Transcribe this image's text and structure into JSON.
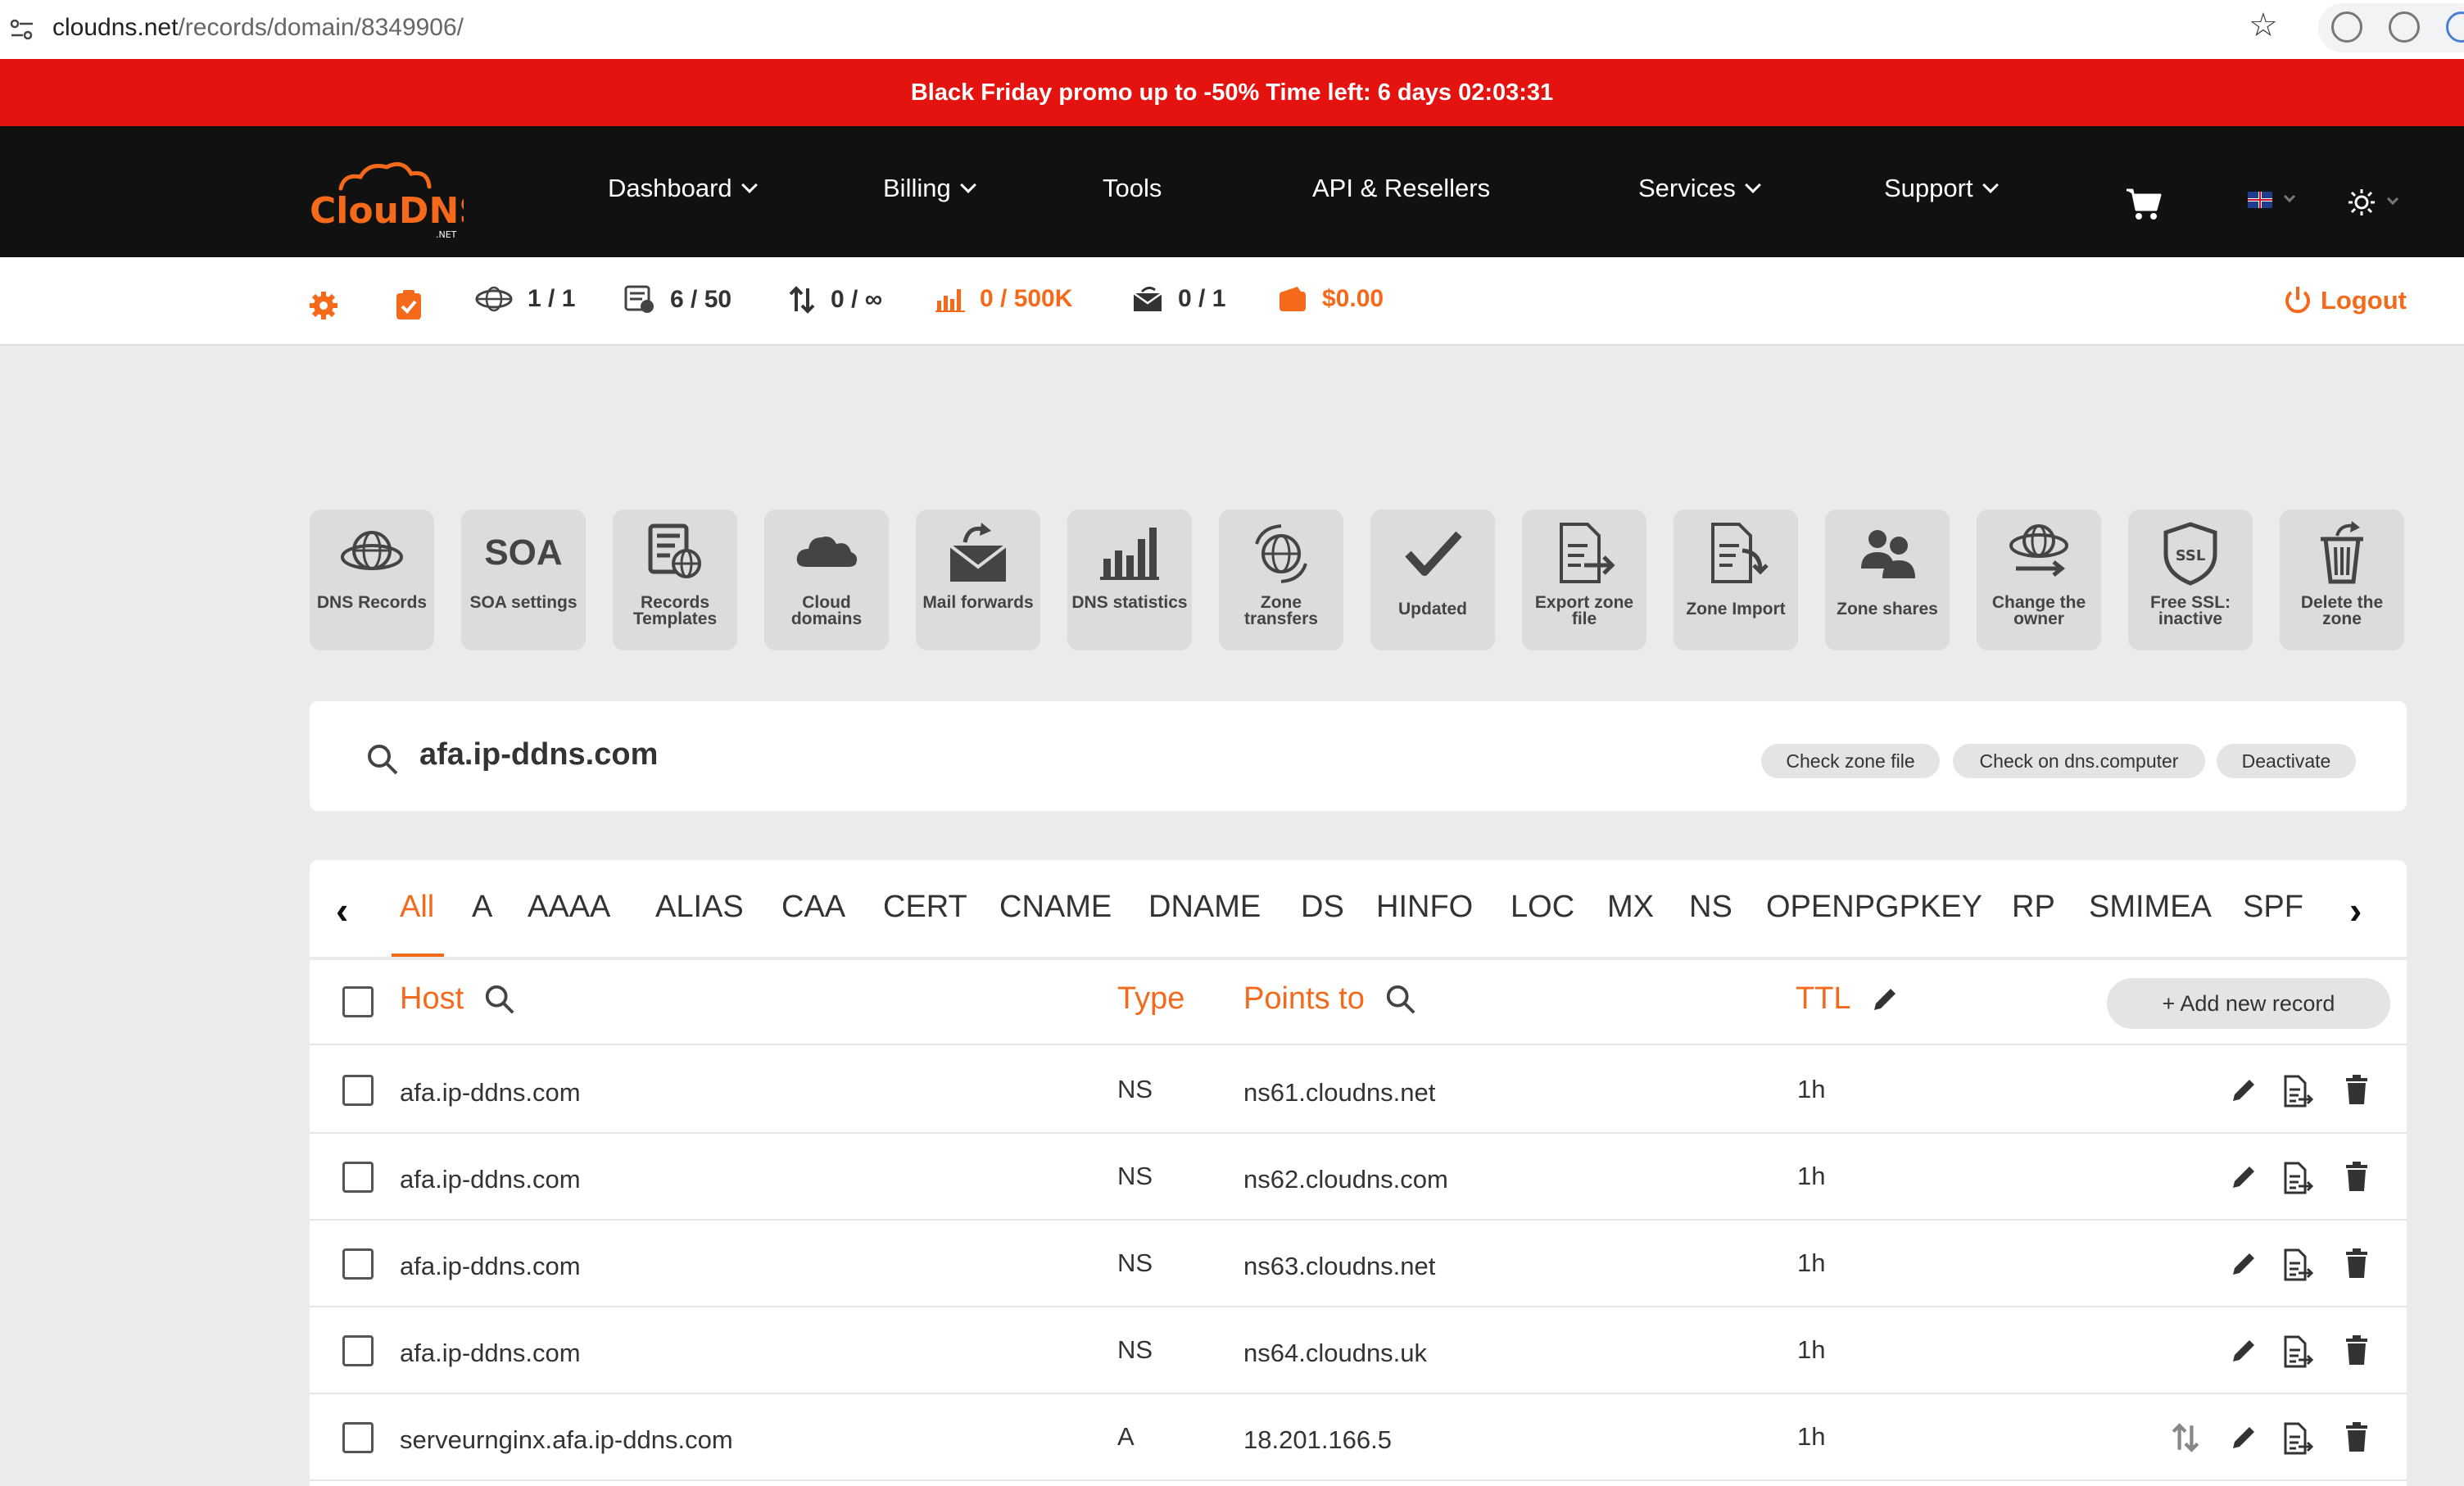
{
  "browser": {
    "url_domain": "cloudns.net",
    "url_path": "/records/domain/8349906/"
  },
  "promo": {
    "text": "Black Friday promo up to -50% Time left: 6 days 02:03:31"
  },
  "brand": {
    "logo_text": "ClouDNS",
    "logo_sub": ".NET",
    "accent": "#f4691a",
    "promo_red": "#e4130f"
  },
  "nav": {
    "items": [
      {
        "label": "Dashboard",
        "dropdown": true
      },
      {
        "label": "Billing",
        "dropdown": true
      },
      {
        "label": "Tools",
        "dropdown": false
      },
      {
        "label": "API & Resellers",
        "dropdown": false
      },
      {
        "label": "Services",
        "dropdown": true
      },
      {
        "label": "Support",
        "dropdown": true
      }
    ],
    "icons": [
      "cart-icon",
      "flag-icon",
      "theme-sun-icon"
    ]
  },
  "stats": {
    "zones": "1 / 1",
    "records": "6 / 50",
    "transfers": "0 / ∞",
    "queries": "0 / 500K",
    "mail": "0 / 1",
    "balance": "$0.00",
    "logout": "Logout"
  },
  "tools": [
    {
      "icon": "globe-icon",
      "label": "DNS Records"
    },
    {
      "icon": "soa-icon",
      "label": "SOA settings",
      "icon_text": "SOA"
    },
    {
      "icon": "template-icon",
      "label": "Records Templates"
    },
    {
      "icon": "cloud-icon",
      "label": "Cloud domains"
    },
    {
      "icon": "mail-forward-icon",
      "label": "Mail forwards"
    },
    {
      "icon": "bar-chart-icon",
      "label": "DNS statistics"
    },
    {
      "icon": "globe-arrows-icon",
      "label": "Zone transfers"
    },
    {
      "icon": "checkmark-icon",
      "label": "Updated"
    },
    {
      "icon": "export-file-icon",
      "label": "Export zone file"
    },
    {
      "icon": "import-file-icon",
      "label": "Zone Import"
    },
    {
      "icon": "users-icon",
      "label": "Zone shares"
    },
    {
      "icon": "globe-owner-icon",
      "label": "Change the owner"
    },
    {
      "icon": "ssl-shield-icon",
      "label": "Free SSL: inactive",
      "icon_text": "SSL"
    },
    {
      "icon": "trash-icon",
      "label": "Delete the zone"
    }
  ],
  "zone": {
    "domain": "afa.ip-ddns.com",
    "buttons": [
      "Check zone file",
      "Check on dns.computer",
      "Deactivate"
    ]
  },
  "record_tabs": [
    "All",
    "A",
    "AAAA",
    "ALIAS",
    "CAA",
    "CERT",
    "CNAME",
    "DNAME",
    "DS",
    "HINFO",
    "LOC",
    "MX",
    "NS",
    "OPENPGPKEY",
    "RP",
    "SMIMEA",
    "SPF"
  ],
  "table": {
    "columns": {
      "host": "Host",
      "type": "Type",
      "points_to": "Points to",
      "ttl": "TTL"
    },
    "add_button": "+ Add new record",
    "rows": [
      {
        "host": "afa.ip-ddns.com",
        "type": "NS",
        "points_to": "ns61.cloudns.net",
        "ttl": "1h"
      },
      {
        "host": "afa.ip-ddns.com",
        "type": "NS",
        "points_to": "ns62.cloudns.com",
        "ttl": "1h"
      },
      {
        "host": "afa.ip-ddns.com",
        "type": "NS",
        "points_to": "ns63.cloudns.net",
        "ttl": "1h"
      },
      {
        "host": "afa.ip-ddns.com",
        "type": "NS",
        "points_to": "ns64.cloudns.uk",
        "ttl": "1h"
      },
      {
        "host": "serveurnginx.afa.ip-ddns.com",
        "type": "A",
        "points_to": "18.201.166.5",
        "ttl": "1h"
      }
    ]
  }
}
